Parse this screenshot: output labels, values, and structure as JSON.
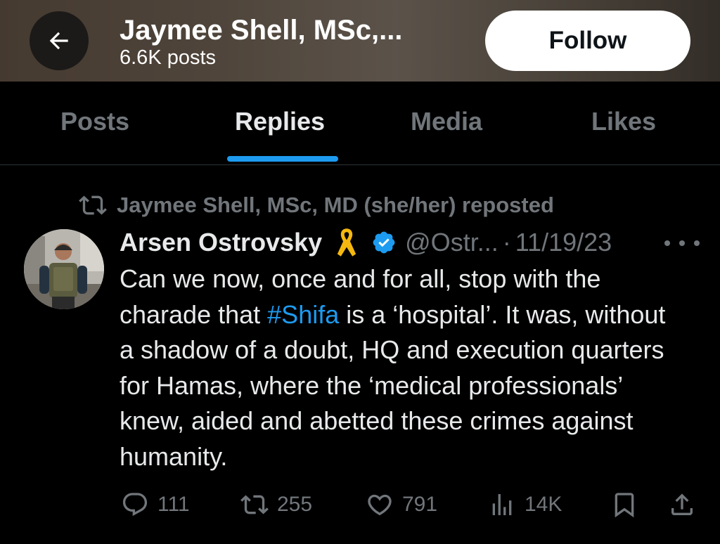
{
  "header": {
    "title": "Jaymee Shell, MSc,...",
    "posts_count": "6.6K posts",
    "follow_label": "Follow"
  },
  "tabs": [
    {
      "label": "Posts",
      "active": false
    },
    {
      "label": "Replies",
      "active": true
    },
    {
      "label": "Media",
      "active": false
    },
    {
      "label": "Likes",
      "active": false
    }
  ],
  "post": {
    "repost_text": "Jaymee Shell, MSc, MD (she/her) reposted",
    "author_name": "Arsen Ostrovsky",
    "handle": "@Ostr...",
    "separator": "·",
    "date": "11/19/23",
    "text_before": "Can we now, once and for all, stop with the charade that ",
    "hashtag": "#Shifa",
    "text_after": " is a ‘hospital’. It was, without a shadow of a doubt, HQ and execution quarters for Hamas, where the ‘medical professionals’ knew, aided and abetted these crimes against humanity.",
    "actions": {
      "replies": "111",
      "reposts": "255",
      "likes": "791",
      "views": "14K"
    }
  },
  "colors": {
    "accent": "#1d9bf0",
    "muted": "#71767b",
    "text": "#e7e9ea",
    "background": "#000000"
  }
}
